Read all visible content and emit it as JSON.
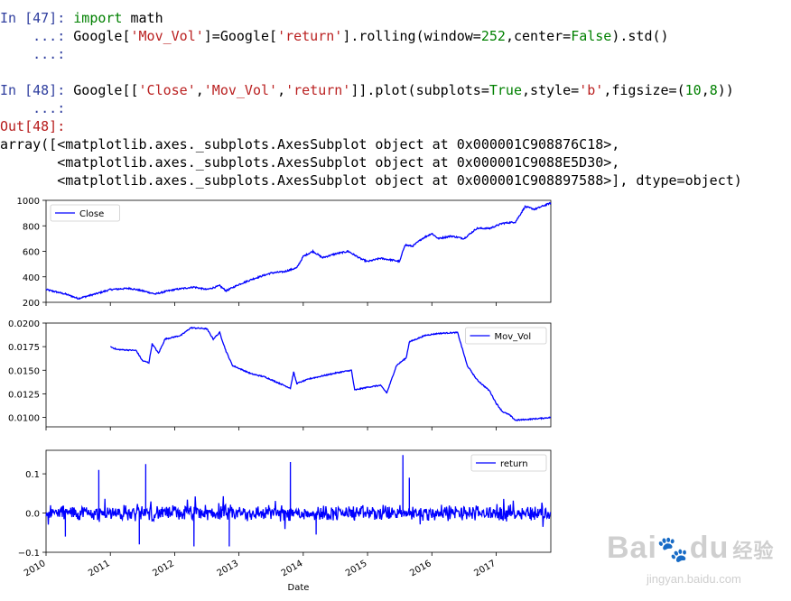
{
  "cells": [
    {
      "prompt": "In [47]:",
      "lines": [
        {
          "cont": "",
          "tokens": [
            {
              "t": "import",
              "c": "kw"
            },
            {
              "t": " math",
              "c": ""
            }
          ]
        },
        {
          "cont": "...:",
          "tokens": [
            {
              "t": "Google[",
              "c": ""
            },
            {
              "t": "'Mov_Vol'",
              "c": "str"
            },
            {
              "t": "]=Google[",
              "c": ""
            },
            {
              "t": "'return'",
              "c": "str"
            },
            {
              "t": "].rolling(window=",
              "c": ""
            },
            {
              "t": "252",
              "c": "num"
            },
            {
              "t": ",center=",
              "c": ""
            },
            {
              "t": "False",
              "c": "bool"
            },
            {
              "t": ").std()",
              "c": ""
            }
          ]
        },
        {
          "cont": "...:",
          "tokens": []
        }
      ]
    },
    {
      "prompt": "In [48]:",
      "lines": [
        {
          "cont": "",
          "tokens": [
            {
              "t": "Google[[",
              "c": ""
            },
            {
              "t": "'Close'",
              "c": "str"
            },
            {
              "t": ",",
              "c": ""
            },
            {
              "t": "'Mov_Vol'",
              "c": "str"
            },
            {
              "t": ",",
              "c": ""
            },
            {
              "t": "'return'",
              "c": "str"
            },
            {
              "t": "]].plot(subplots=",
              "c": ""
            },
            {
              "t": "True",
              "c": "bool"
            },
            {
              "t": ",style=",
              "c": ""
            },
            {
              "t": "'b'",
              "c": "str"
            },
            {
              "t": ",figsize=(",
              "c": ""
            },
            {
              "t": "10",
              "c": "num"
            },
            {
              "t": ",",
              "c": ""
            },
            {
              "t": "8",
              "c": "num"
            },
            {
              "t": "))",
              "c": ""
            }
          ]
        },
        {
          "cont": "...:",
          "tokens": []
        }
      ]
    }
  ],
  "output": {
    "prompt": "Out[48]:",
    "lines": [
      "array([<matplotlib.axes._subplots.AxesSubplot object at 0x000001C908876C18>,",
      "       <matplotlib.axes._subplots.AxesSubplot object at 0x000001C9088E5D30>,",
      "       <matplotlib.axes._subplots.AxesSubplot object at 0x000001C908897588>], dtype=object)"
    ]
  },
  "chart_data": [
    {
      "type": "line",
      "series": [
        {
          "name": "Close",
          "color": "#0000ff"
        }
      ],
      "x_range": [
        2010,
        2017.85
      ],
      "ylim": [
        200,
        1000
      ],
      "y_ticks": [
        "200",
        "400",
        "600",
        "800",
        "1000"
      ],
      "legend": "top-left",
      "anchors": [
        [
          2010.0,
          300
        ],
        [
          2010.3,
          265
        ],
        [
          2010.5,
          230
        ],
        [
          2010.8,
          270
        ],
        [
          2011.0,
          300
        ],
        [
          2011.3,
          310
        ],
        [
          2011.5,
          290
        ],
        [
          2011.7,
          265
        ],
        [
          2011.9,
          290
        ],
        [
          2012.0,
          300
        ],
        [
          2012.3,
          320
        ],
        [
          2012.5,
          300
        ],
        [
          2012.7,
          330
        ],
        [
          2012.8,
          290
        ],
        [
          2013.0,
          340
        ],
        [
          2013.2,
          380
        ],
        [
          2013.5,
          430
        ],
        [
          2013.7,
          440
        ],
        [
          2013.9,
          470
        ],
        [
          2014.0,
          560
        ],
        [
          2014.15,
          600
        ],
        [
          2014.3,
          550
        ],
        [
          2014.5,
          580
        ],
        [
          2014.7,
          600
        ],
        [
          2014.9,
          540
        ],
        [
          2015.0,
          520
        ],
        [
          2015.2,
          545
        ],
        [
          2015.4,
          530
        ],
        [
          2015.5,
          520
        ],
        [
          2015.58,
          650
        ],
        [
          2015.7,
          640
        ],
        [
          2015.85,
          700
        ],
        [
          2016.0,
          740
        ],
        [
          2016.1,
          700
        ],
        [
          2016.3,
          720
        ],
        [
          2016.5,
          700
        ],
        [
          2016.7,
          780
        ],
        [
          2016.9,
          780
        ],
        [
          2017.1,
          820
        ],
        [
          2017.3,
          830
        ],
        [
          2017.45,
          950
        ],
        [
          2017.6,
          930
        ],
        [
          2017.75,
          960
        ],
        [
          2017.85,
          980
        ]
      ]
    },
    {
      "type": "line",
      "series": [
        {
          "name": "Mov_Vol",
          "color": "#0000ff"
        }
      ],
      "x_range": [
        2010,
        2017.85
      ],
      "ylim": [
        0.009,
        0.02
      ],
      "y_ticks": [
        "0.0100",
        "0.0125",
        "0.0150",
        "0.0175",
        "0.0200"
      ],
      "legend": "top-right",
      "anchors": [
        [
          2011.0,
          0.0175
        ],
        [
          2011.1,
          0.0172
        ],
        [
          2011.4,
          0.0171
        ],
        [
          2011.5,
          0.016
        ],
        [
          2011.6,
          0.0158
        ],
        [
          2011.65,
          0.0178
        ],
        [
          2011.75,
          0.0168
        ],
        [
          2011.85,
          0.0183
        ],
        [
          2012.1,
          0.0187
        ],
        [
          2012.25,
          0.0195
        ],
        [
          2012.5,
          0.0194
        ],
        [
          2012.6,
          0.0183
        ],
        [
          2012.7,
          0.019
        ],
        [
          2012.8,
          0.017
        ],
        [
          2012.9,
          0.0155
        ],
        [
          2013.0,
          0.0152
        ],
        [
          2013.2,
          0.0146
        ],
        [
          2013.4,
          0.0143
        ],
        [
          2013.6,
          0.0137
        ],
        [
          2013.8,
          0.0131
        ],
        [
          2013.85,
          0.0148
        ],
        [
          2013.9,
          0.0136
        ],
        [
          2014.1,
          0.0141
        ],
        [
          2014.3,
          0.0144
        ],
        [
          2014.5,
          0.0147
        ],
        [
          2014.75,
          0.015
        ],
        [
          2014.8,
          0.0129
        ],
        [
          2015.0,
          0.0132
        ],
        [
          2015.2,
          0.0134
        ],
        [
          2015.3,
          0.0126
        ],
        [
          2015.45,
          0.0155
        ],
        [
          2015.6,
          0.0163
        ],
        [
          2015.65,
          0.018
        ],
        [
          2015.9,
          0.0187
        ],
        [
          2016.1,
          0.0189
        ],
        [
          2016.4,
          0.019
        ],
        [
          2016.55,
          0.0155
        ],
        [
          2016.7,
          0.014
        ],
        [
          2016.9,
          0.0128
        ],
        [
          2017.0,
          0.0115
        ],
        [
          2017.1,
          0.0106
        ],
        [
          2017.2,
          0.0103
        ],
        [
          2017.3,
          0.0097
        ],
        [
          2017.5,
          0.0098
        ],
        [
          2017.7,
          0.0099
        ],
        [
          2017.85,
          0.01
        ]
      ]
    },
    {
      "type": "line",
      "series": [
        {
          "name": "return",
          "color": "#0000ff"
        }
      ],
      "x_range": [
        2010,
        2017.85
      ],
      "ylim": [
        -0.1,
        0.16
      ],
      "y_ticks": [
        "−0.1",
        "0.0",
        "0.1"
      ],
      "legend": "top-right",
      "spikes": [
        [
          2010.82,
          0.11
        ],
        [
          2011.55,
          0.125
        ],
        [
          2013.8,
          0.13
        ],
        [
          2015.55,
          0.148
        ],
        [
          2015.65,
          0.09
        ],
        [
          2012.85,
          -0.085
        ],
        [
          2012.3,
          -0.085
        ],
        [
          2011.45,
          -0.08
        ],
        [
          2014.2,
          -0.055
        ],
        [
          2010.3,
          -0.06
        ]
      ],
      "noise_amplitude": 0.02
    }
  ],
  "x_axis": {
    "label": "Date",
    "ticks": [
      "2010",
      "2011",
      "2012",
      "2013",
      "2014",
      "2015",
      "2016",
      "2017"
    ]
  },
  "watermark": {
    "logo": "Bai du 经验",
    "url": "jingyan.baidu.com"
  }
}
